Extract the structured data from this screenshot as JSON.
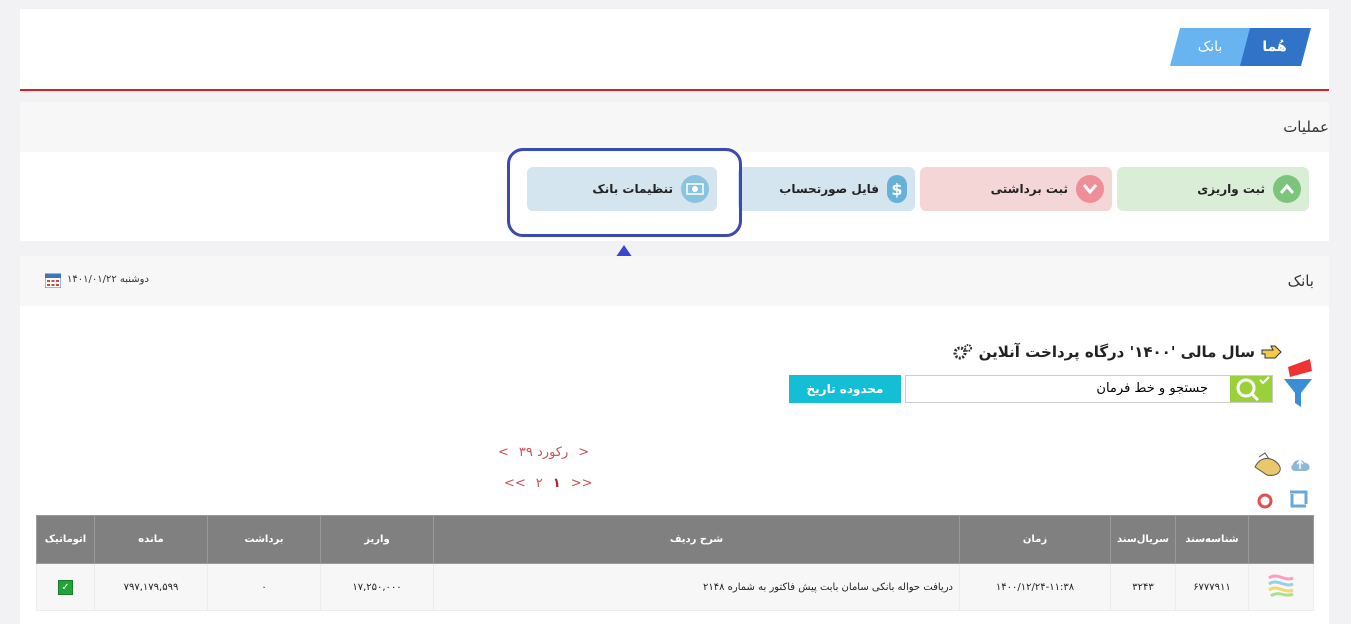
{
  "breadcrumb": {
    "home": "هُما",
    "bank": "بانک"
  },
  "operations": {
    "title": "عملیات",
    "buttons": [
      {
        "label": "ثبت واریزی",
        "icon": "chevron-up-icon",
        "color": "#daeed7"
      },
      {
        "label": "ثبت برداشتی",
        "icon": "chevron-down-icon",
        "color": "#f5d6d6"
      },
      {
        "label": "فایل صورتحساب",
        "icon": "dollar-icon",
        "color": "#d4e5f0"
      },
      {
        "label": "تنظیمات بانک",
        "icon": "money-icon",
        "color": "#d4e5f0"
      }
    ]
  },
  "bank_section": {
    "title": "بانک",
    "date": "دوشنبه ۱۴۰۱/۰۱/۲۲",
    "year_title": "سال مالی '۱۴۰۰' درگاه پرداخت آنلاین",
    "search_value": "جستجو و خط فرمان",
    "date_range_button": "محدوده تاریخ",
    "record_count": "۳۹ رکورد",
    "pages": [
      "۱",
      "۲"
    ],
    "nav": {
      "prev": "<",
      "next": ">",
      "first": "<<",
      "last": ">>"
    }
  },
  "table": {
    "headers": [
      "",
      "شناسه‌سند",
      "سریال‌سند",
      "زمان",
      "شرح ردیف",
      "واریز",
      "برداشت",
      "مانده",
      "اتوماتیک"
    ],
    "rows": [
      {
        "doc_id": "۶۷۷۷۹۱۱",
        "serial": "۳۲۴۳",
        "time": "۱۴۰۰/۱۲/۲۴-۱۱:۳۸",
        "description": "دریافت حواله بانکی سامان بابت پیش فاکتور به شماره ۲۱۴۸",
        "deposit": "۱۷,۲۵۰,۰۰۰",
        "withdraw": "۰",
        "balance": "۷۹۷,۱۷۹,۵۹۹",
        "auto": true
      }
    ]
  },
  "colors": {
    "accent": "#d71f26",
    "highlight": "#3b49b5",
    "header_bg": "#808080",
    "date_button": "#14bfd6"
  }
}
